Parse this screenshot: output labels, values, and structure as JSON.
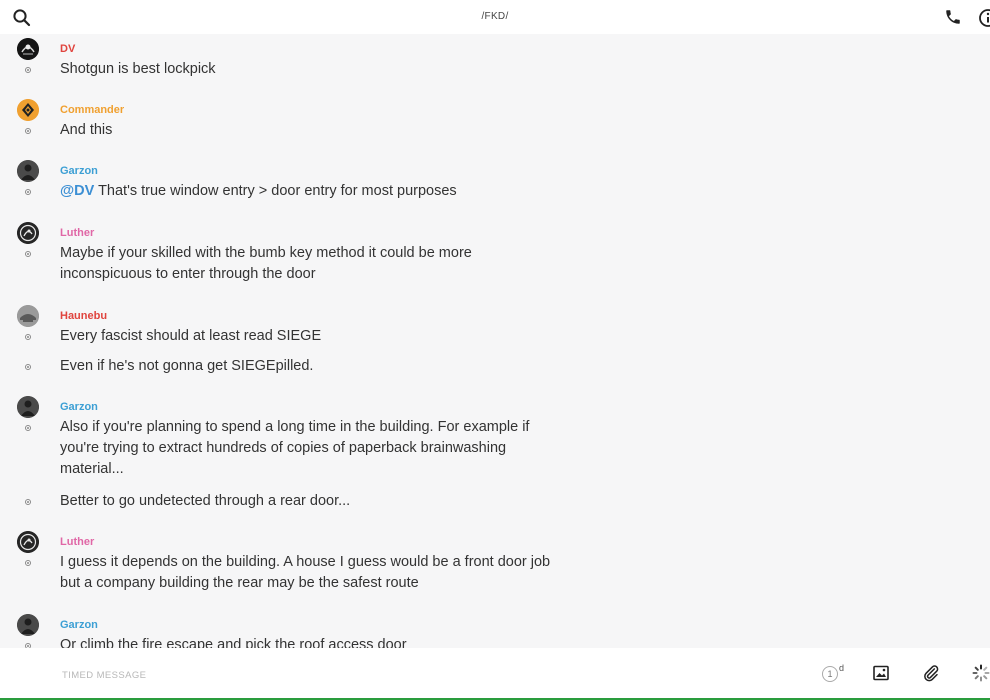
{
  "header": {
    "title": "/FKD/",
    "icons": {
      "search": "search-icon",
      "call": "phone-icon",
      "info": "info-icon"
    }
  },
  "colors": {
    "red": "#e0443e",
    "orange": "#f0a030",
    "blue": "#3c9fd4",
    "pink": "#e067a6",
    "mention": "#3c8fd4"
  },
  "messages": [
    {
      "author": "DV",
      "author_color": "#e0443e",
      "lines": [
        "Shotgun is best lockpick"
      ]
    },
    {
      "author": "Commander",
      "author_color": "#f0a030",
      "lines": [
        "And this"
      ]
    },
    {
      "author": "Garzon",
      "author_color": "#3c9fd4",
      "mention": "@DV",
      "lines": [
        " That's true window entry > door entry for most purposes"
      ]
    },
    {
      "author": "Luther",
      "author_color": "#e067a6",
      "lines": [
        "Maybe if your skilled with the bumb key method it could be more inconspicuous to enter through the door"
      ]
    },
    {
      "author": "Haunebu",
      "author_color": "#e0443e",
      "lines": [
        "Every fascist should at least read SIEGE",
        "Even if he's not gonna get SIEGEpilled."
      ]
    },
    {
      "author": "Garzon",
      "author_color": "#3c9fd4",
      "lines": [
        "Also if you're planning to spend a long time in the building. For example if you're trying to extract hundreds of copies of paperback brainwashing material...",
        "Better to go undetected through a rear door..."
      ]
    },
    {
      "author": "Luther",
      "author_color": "#e067a6",
      "lines": [
        "I guess it depends on the building. A house I guess would be a front door job but a company building the rear may be the safest route"
      ]
    },
    {
      "author": "Garzon",
      "author_color": "#3c9fd4",
      "lines": [
        "Or climb the fire escape and pick the roof access door"
      ]
    }
  ],
  "composer": {
    "placeholder": "TIMED MESSAGE",
    "timer_value": "1",
    "timer_unit": "d",
    "icons": {
      "image": "image-icon",
      "attach": "paperclip-icon",
      "more": "spinner-icon"
    }
  }
}
